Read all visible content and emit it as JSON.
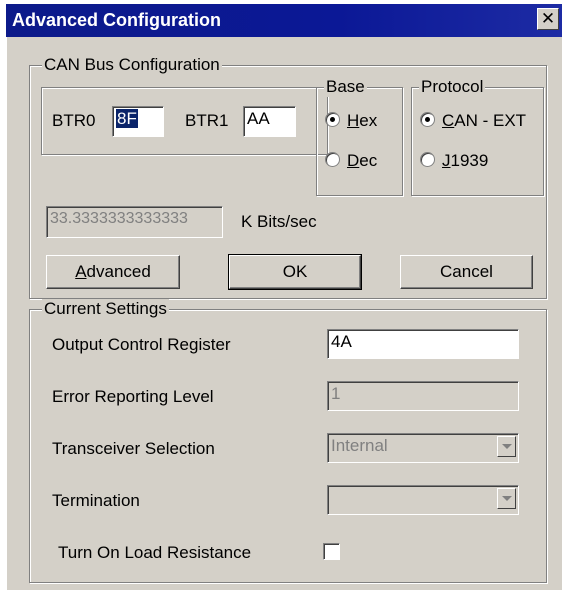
{
  "window": {
    "title": "Advanced Configuration",
    "close_glyph": "✕"
  },
  "can_bus": {
    "legend": "CAN Bus Configuration",
    "btr0_label": "BTR0",
    "btr0_value": "8F",
    "btr1_label": "BTR1",
    "btr1_value": "AA",
    "rate_value": "33.3333333333333",
    "rate_unit": "K Bits/sec",
    "base": {
      "legend": "Base",
      "options": [
        {
          "prefix": "",
          "mnemonic": "H",
          "rest": "ex",
          "selected": true
        },
        {
          "prefix": "",
          "mnemonic": "D",
          "rest": "ec",
          "selected": false
        }
      ]
    },
    "protocol": {
      "legend": "Protocol",
      "options": [
        {
          "prefix": "",
          "mnemonic": "C",
          "rest": "AN - EXT",
          "selected": true
        },
        {
          "prefix": "",
          "mnemonic": "J",
          "rest": "1939",
          "selected": false
        }
      ]
    },
    "buttons": {
      "advanced": {
        "mnemonic": "A",
        "rest": "dvanced"
      },
      "ok": "OK",
      "cancel": "Cancel"
    }
  },
  "current": {
    "legend": "Current Settings",
    "output_control_label": "Output Control Register",
    "output_control_value": "4A",
    "error_level_label": "Error Reporting Level",
    "error_level_value": "1",
    "transceiver_label": "Transceiver Selection",
    "transceiver_value": "Internal",
    "termination_label": "Termination",
    "termination_value": "",
    "load_resistance_label": "Turn On Load Resistance",
    "load_resistance_checked": false
  }
}
